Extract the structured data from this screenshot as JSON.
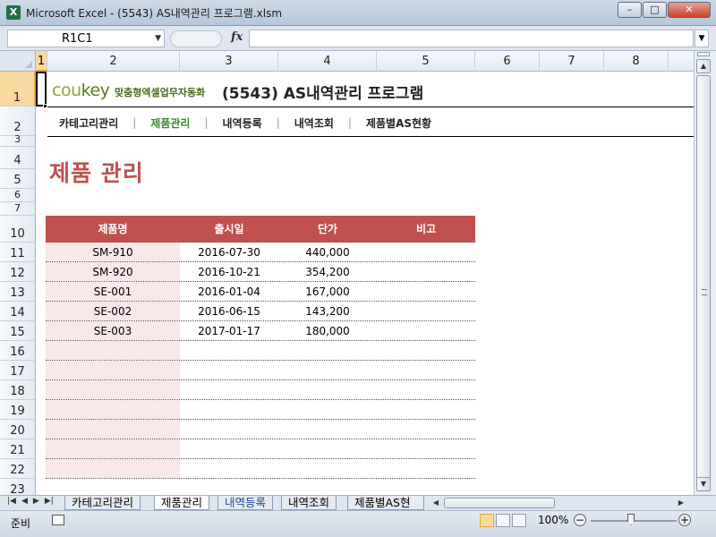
{
  "window": {
    "title": "Microsoft Excel - (5543) AS내역관리 프로그램.xlsm",
    "app_icon": "X",
    "minimize": "–",
    "maximize": "□",
    "close": "✕"
  },
  "formula_bar": {
    "name_box": "R1C1",
    "fx": "fx",
    "formula": ""
  },
  "columns": [
    "1",
    "2",
    "3",
    "4",
    "5",
    "6",
    "7",
    "8"
  ],
  "rows": [
    "1",
    "2",
    "3",
    "4",
    "5",
    "6",
    "7",
    "10",
    "11",
    "12",
    "13",
    "14",
    "15",
    "16",
    "17",
    "18",
    "19",
    "20",
    "21",
    "22",
    "23"
  ],
  "header": {
    "logo_text": "coukey",
    "tagline": "맞춤형엑셀업무자동화",
    "title": "(5543) AS내역관리 프로그램"
  },
  "nav": {
    "items": [
      "카테고리관리",
      "제품관리",
      "내역등록",
      "내역조회",
      "제품별AS현황"
    ],
    "active_index": 1
  },
  "page_title": "제품 관리",
  "table": {
    "headers": [
      "제품명",
      "출시일",
      "단가",
      "비고"
    ],
    "rows": [
      [
        "SM-910",
        "2016-07-30",
        "440,000",
        ""
      ],
      [
        "SM-920",
        "2016-10-21",
        "354,200",
        ""
      ],
      [
        "SE-001",
        "2016-01-04",
        "167,000",
        ""
      ],
      [
        "SE-002",
        "2016-06-15",
        "143,200",
        ""
      ],
      [
        "SE-003",
        "2017-01-17",
        "180,000",
        ""
      ],
      [
        "",
        "",
        "",
        ""
      ],
      [
        "",
        "",
        "",
        ""
      ],
      [
        "",
        "",
        "",
        ""
      ],
      [
        "",
        "",
        "",
        ""
      ],
      [
        "",
        "",
        "",
        ""
      ],
      [
        "",
        "",
        "",
        ""
      ],
      [
        "",
        "",
        "",
        ""
      ]
    ]
  },
  "sheet_tabs": [
    "카테고리관리",
    "제품관리",
    "내역등록",
    "내역조회",
    "제품별AS현"
  ],
  "active_sheet": "제품관리",
  "status": {
    "ready": "준비",
    "zoom": "100%",
    "zoom_fraction": 0.5
  },
  "colors": {
    "accent_red": "#c0504d",
    "nav_active_green": "#3c8a2e",
    "logo_green": "#8aa835",
    "first_col_fill": "#f9e8e8"
  }
}
